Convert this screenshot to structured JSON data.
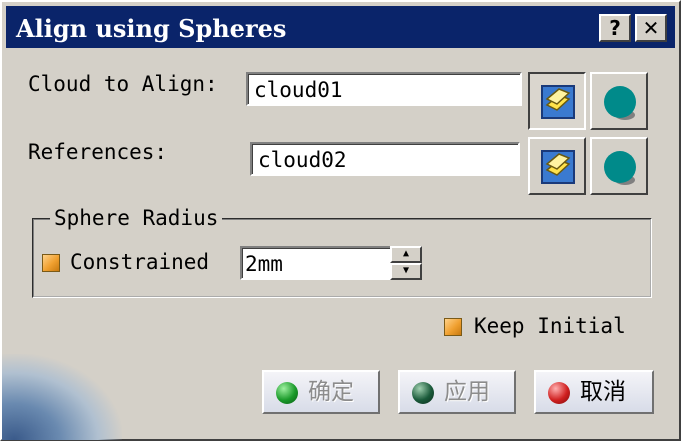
{
  "window": {
    "title": "Align using Spheres",
    "help_label": "?",
    "close_label": "✕"
  },
  "cloud_to_align": {
    "label": "Cloud to Align:",
    "value": "cloud01"
  },
  "references": {
    "label": "References:",
    "value": "cloud02"
  },
  "sphere_radius": {
    "legend": "Sphere Radius",
    "constrained_label": "Constrained",
    "value": "2mm"
  },
  "keep_initial": {
    "label": "Keep Initial"
  },
  "buttons": {
    "ok_label": "确定",
    "apply_label": "应用",
    "cancel_label": "取消"
  },
  "icons": {
    "list": "cloud-list-icon",
    "sphere": "sphere-icon"
  },
  "colors": {
    "titlebar": "#0a246a",
    "sphere": "#008a8a",
    "checkbox": "#f0a030",
    "ok_ball": "#1a9a2a",
    "apply_ball": "#1a5a3a",
    "cancel_ball": "#d02020"
  }
}
